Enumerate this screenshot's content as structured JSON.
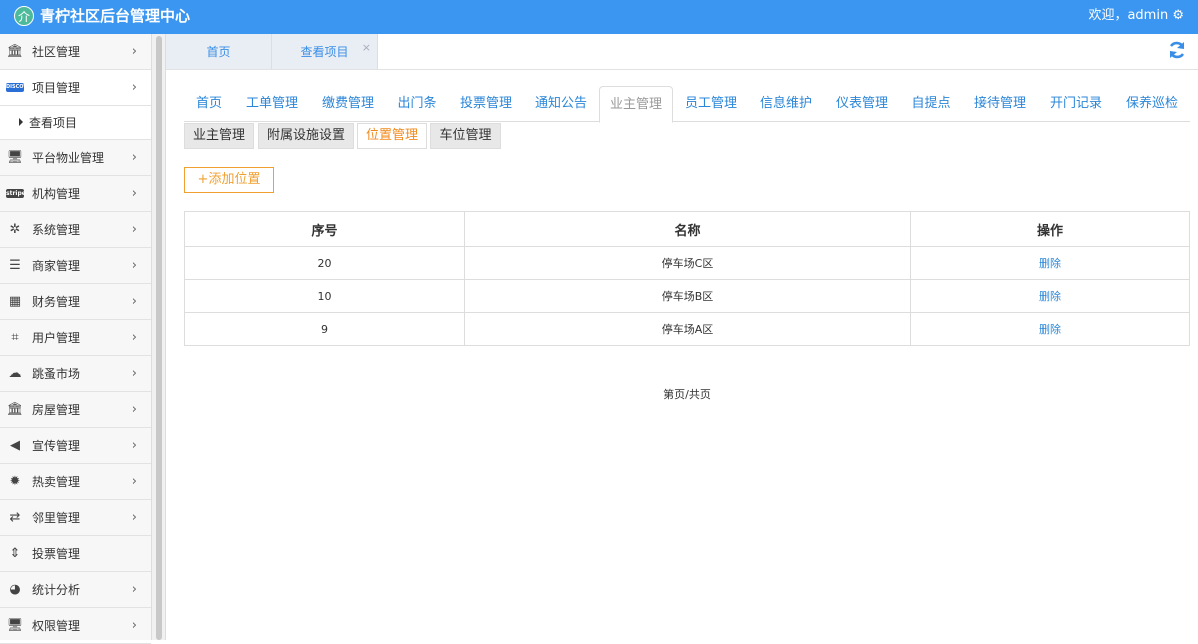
{
  "header": {
    "logo_glyph": "介",
    "title": "青柠社区后台管理中心",
    "welcome": "欢迎，admin ⚙"
  },
  "sidebar": {
    "items": [
      {
        "icon": "bank-icon",
        "glyph": "🏛",
        "label": "社区管理",
        "arrow": "›"
      },
      {
        "icon": "discover-card-icon",
        "glyph": "DISCOVER",
        "label": "项目管理",
        "arrow": "›",
        "open": true
      },
      {
        "icon": "monitor-icon",
        "glyph": "🖥",
        "label": "平台物业管理",
        "arrow": "›"
      },
      {
        "icon": "stripe-icon",
        "glyph": "stripe",
        "label": "机构管理",
        "arrow": "›"
      },
      {
        "icon": "yelp-icon",
        "glyph": "✲",
        "label": "系统管理",
        "arrow": "›"
      },
      {
        "icon": "bars-icon",
        "glyph": "☰",
        "label": "商家管理",
        "arrow": "›"
      },
      {
        "icon": "calculator-icon",
        "glyph": "▦",
        "label": "财务管理",
        "arrow": "›"
      },
      {
        "icon": "crop-icon",
        "glyph": "⌗",
        "label": "用户管理",
        "arrow": "›"
      },
      {
        "icon": "cloud-icon",
        "glyph": "☁",
        "label": "跳蚤市场",
        "arrow": "›"
      },
      {
        "icon": "bank-icon",
        "glyph": "🏛",
        "label": "房屋管理",
        "arrow": "›"
      },
      {
        "icon": "volume-icon",
        "glyph": "◀",
        "label": "宣传管理",
        "arrow": "›"
      },
      {
        "icon": "sun-icon",
        "glyph": "✹",
        "label": "热卖管理",
        "arrow": "›"
      },
      {
        "icon": "retweet-icon",
        "glyph": "⇄",
        "label": "邻里管理",
        "arrow": "›"
      },
      {
        "icon": "sort-icon",
        "glyph": "⇕",
        "label": "投票管理",
        "arrow": ""
      },
      {
        "icon": "pie-chart-icon",
        "glyph": "◕",
        "label": "统计分析",
        "arrow": "›"
      },
      {
        "icon": "monitor-icon",
        "glyph": "🖥",
        "label": "权限管理",
        "arrow": "›"
      }
    ],
    "sub_item": "查看项目"
  },
  "page_tabs": [
    {
      "label": "首页"
    },
    {
      "label": "查看项目",
      "close": "×"
    }
  ],
  "module_tabs": [
    "首页",
    "工单管理",
    "缴费管理",
    "出门条",
    "投票管理",
    "通知公告",
    "业主管理",
    "员工管理",
    "信息维护",
    "仪表管理",
    "自提点",
    "接待管理",
    "开门记录",
    "保养巡检"
  ],
  "active_module": 6,
  "sub_tabs": [
    "业主管理",
    "附属设施设置",
    "位置管理",
    "车位管理"
  ],
  "active_sub": 2,
  "add_button": "+添加位置",
  "table": {
    "headers": [
      "序号",
      "名称",
      "操作"
    ],
    "rows": [
      {
        "id": "20",
        "name": "停车场C区",
        "action": "删除"
      },
      {
        "id": "10",
        "name": "停车场B区",
        "action": "删除"
      },
      {
        "id": "9",
        "name": "停车场A区",
        "action": "删除"
      }
    ]
  },
  "pager": "第页/共页",
  "colors": {
    "header_bg": "#3a96f0",
    "link": "#2a86d8",
    "accent_orange": "#f08a1c"
  }
}
